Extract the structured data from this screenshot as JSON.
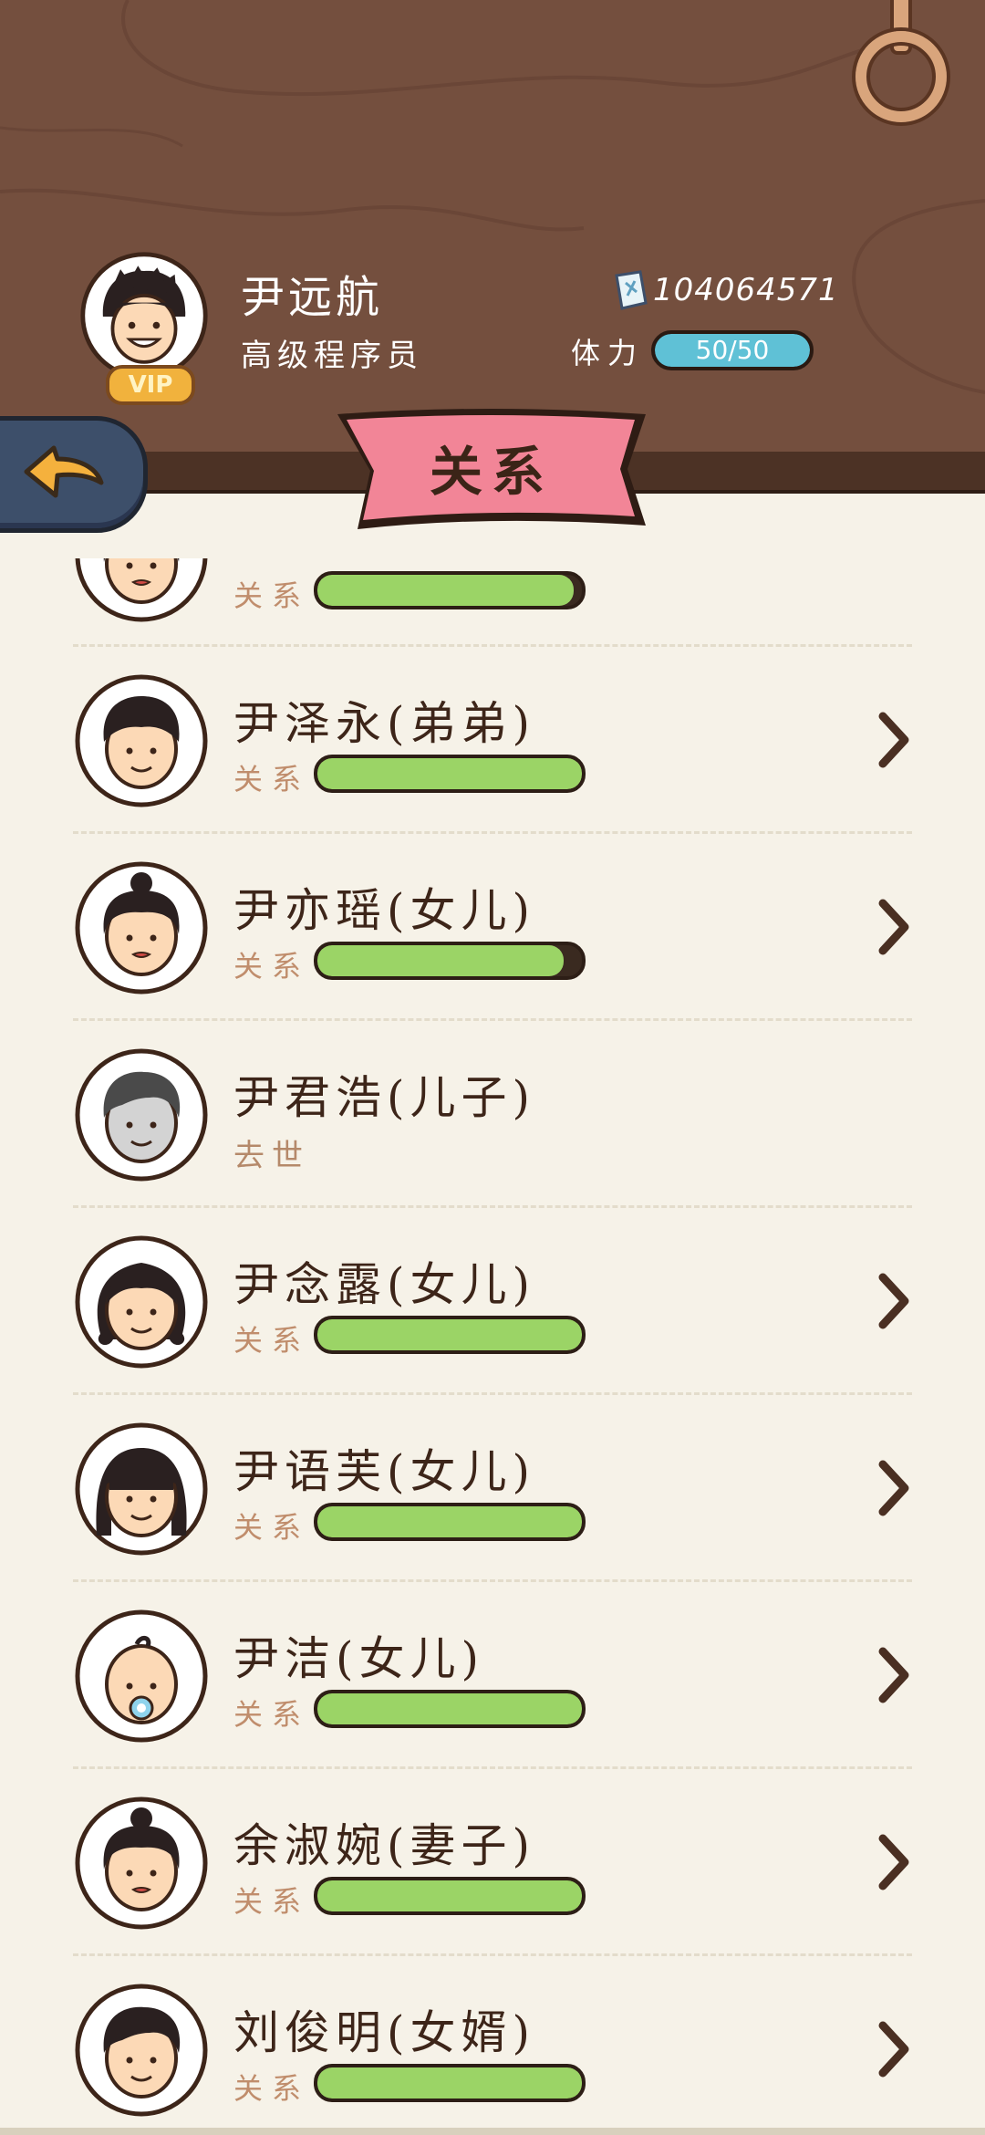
{
  "colors": {
    "header_wood": "#744f3e",
    "banner_pink": "#f28597",
    "relation_bar": "#9bd466",
    "stamina_bar": "#5fc1d6",
    "page_bg": "#f6f2e8"
  },
  "profile": {
    "name": "尹远航",
    "title": "高级程序员",
    "vip": "VIP",
    "money": "104064571",
    "money_icon": "banknote-icon",
    "stamina_label": "体力",
    "stamina_text": "50/50",
    "stamina_fraction": 1.0
  },
  "nav": {
    "back_icon": "back-arrow-icon",
    "banner_title": "关系"
  },
  "list": {
    "relation_label": "关系",
    "items": [
      {
        "name": "",
        "avatar": "woman",
        "relation": 0.97,
        "deceased": false
      },
      {
        "name": "尹泽永(弟弟)",
        "avatar": "boy",
        "relation": 1.0,
        "deceased": false
      },
      {
        "name": "尹亦瑶(女儿)",
        "avatar": "woman-bun",
        "relation": 0.93,
        "deceased": false
      },
      {
        "name": "尹君浩(儿子)",
        "avatar": "man-gray",
        "relation": 0,
        "deceased": true,
        "status": "去世"
      },
      {
        "name": "尹念露(女儿)",
        "avatar": "girl-curly",
        "relation": 1.0,
        "deceased": false
      },
      {
        "name": "尹语芙(女儿)",
        "avatar": "girl-long",
        "relation": 1.0,
        "deceased": false
      },
      {
        "name": "尹洁(女儿)",
        "avatar": "baby",
        "relation": 1.0,
        "deceased": false
      },
      {
        "name": "余淑婉(妻子)",
        "avatar": "woman-bun",
        "relation": 1.0,
        "deceased": false
      },
      {
        "name": "刘俊明(女婿)",
        "avatar": "man",
        "relation": 1.0,
        "deceased": false
      }
    ]
  }
}
